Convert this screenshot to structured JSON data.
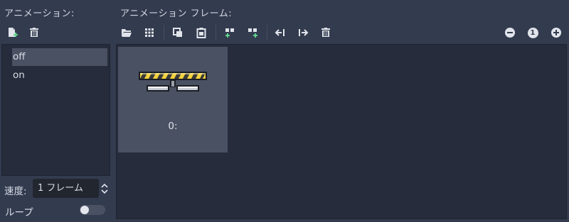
{
  "animations_panel": {
    "title": "アニメーション:",
    "items": [
      {
        "label": "off",
        "selected": true
      },
      {
        "label": "on",
        "selected": false
      }
    ],
    "speed_label": "速度:",
    "speed_value": "1 フレーム",
    "loop_label": "ループ",
    "loop_enabled": false
  },
  "frames_panel": {
    "title": "アニメーション フレーム:",
    "frames": [
      {
        "label": "0:"
      }
    ],
    "zoom_reset_label": "1"
  },
  "colors": {
    "background": "#333b4f",
    "panel": "#262c3b",
    "selected": "#4a5163",
    "add_accent": "#5fd38d",
    "sprite_yellow": "#f2d13a"
  },
  "icons": {
    "new_animation": "new-file-icon",
    "remove_animation": "trash-icon",
    "load_frames": "folder-open-icon",
    "load_from_sheet": "grid-icon",
    "copy": "copy-icon",
    "paste": "paste-icon",
    "insert_before": "insert-before-icon",
    "insert_after": "insert-after-icon",
    "move_left": "move-left-icon",
    "move_right": "move-right-icon",
    "delete_frame": "trash-icon",
    "zoom_out": "zoom-out-icon",
    "zoom_in": "zoom-in-icon"
  }
}
